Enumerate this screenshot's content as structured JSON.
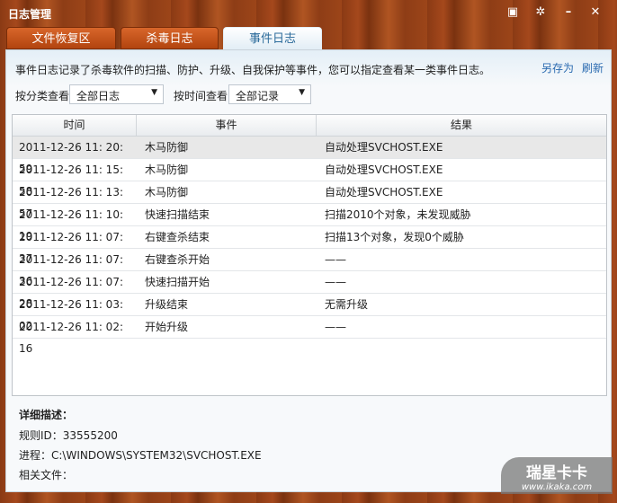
{
  "window": {
    "title": "日志管理",
    "controls": [
      "menu",
      "settings",
      "minimize",
      "close"
    ]
  },
  "tabs": [
    {
      "label": "文件恢复区"
    },
    {
      "label": "杀毒日志"
    },
    {
      "label": "事件日志"
    }
  ],
  "description": "事件日志记录了杀毒软件的扫描、防护、升级、自我保护等事件，您可以指定查看某一类事件日志。",
  "links": {
    "save_as": "另存为",
    "refresh": "刷新"
  },
  "filters": {
    "category_label": "按分类查看",
    "category_value": "全部日志",
    "time_label": "按时间查看",
    "time_value": "全部记录"
  },
  "table": {
    "headers": [
      "时间",
      "事件",
      "结果"
    ],
    "rows": [
      [
        "2011-12-26 11: 20: 59",
        "木马防御",
        "自动处理SVCHOST.EXE"
      ],
      [
        "2011-12-26 11: 15: 58",
        "木马防御",
        "自动处理SVCHOST.EXE"
      ],
      [
        "2011-12-26 11: 13: 57",
        "木马防御",
        "自动处理SVCHOST.EXE"
      ],
      [
        "2011-12-26 11: 10: 19",
        "快速扫描结束",
        "扫描2010个对象，未发现威胁"
      ],
      [
        "2011-12-26 11: 07: 37",
        "右键查杀结束",
        "扫描13个对象，发现0个威胁"
      ],
      [
        "2011-12-26 11: 07: 36",
        "右键查杀开始",
        "——"
      ],
      [
        "2011-12-26 11: 07: 28",
        "快速扫描开始",
        "——"
      ],
      [
        "2011-12-26 11: 03: 02",
        "升级结束",
        "无需升级"
      ],
      [
        "2011-12-26 11: 02: 16",
        "开始升级",
        "——"
      ]
    ]
  },
  "details": {
    "title": "详细描述：",
    "rule_id": "规则ID：33555200",
    "process": "进程：C:\\WINDOWS\\SYSTEM32\\SVCHOST.EXE",
    "files": "相关文件："
  },
  "watermark": {
    "brand": "瑞星卡卡",
    "url": "www.ikaka.com"
  }
}
